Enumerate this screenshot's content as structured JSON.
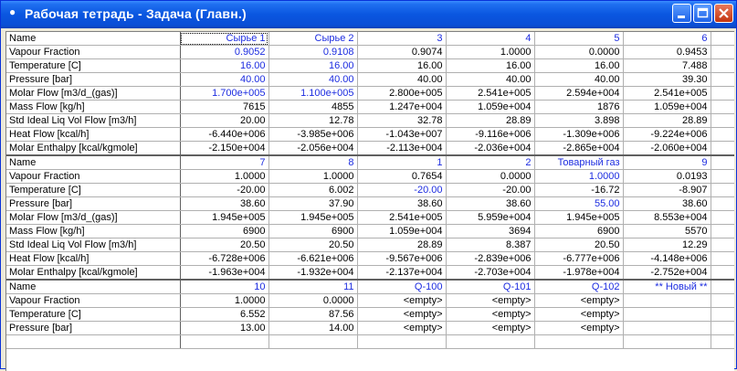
{
  "window": {
    "title": "Рабочая тетрадь - Задача (Главн.)",
    "minimize_label": "",
    "maximize_label": "",
    "close_label": ""
  },
  "grid": {
    "row_labels": [
      "Name",
      "Vapour Fraction",
      "Temperature [C]",
      "Pressure [bar]",
      "Molar Flow [m3/d_(gas)]",
      "Mass Flow [kg/h]",
      "Std Ideal Liq Vol Flow [m3/h]",
      "Heat Flow [kcal/h]",
      "Molar Enthalpy [kcal/kgmole]"
    ],
    "blocks": [
      {
        "names": [
          "Сырье 1",
          "Сырье 2",
          "3",
          "4",
          "5",
          "6"
        ],
        "rows": [
          [
            "0.9052",
            "0.9108",
            "0.9074",
            "1.0000",
            "0.0000",
            "0.9453"
          ],
          [
            "16.00",
            "16.00",
            "16.00",
            "16.00",
            "16.00",
            "7.488"
          ],
          [
            "40.00",
            "40.00",
            "40.00",
            "40.00",
            "40.00",
            "39.30"
          ],
          [
            "1.700e+005",
            "1.100e+005",
            "2.800e+005",
            "2.541e+005",
            "2.594e+004",
            "2.541e+005"
          ],
          [
            "7615",
            "4855",
            "1.247e+004",
            "1.059e+004",
            "1876",
            "1.059e+004"
          ],
          [
            "20.00",
            "12.78",
            "32.78",
            "28.89",
            "3.898",
            "28.89"
          ],
          [
            "-6.440e+006",
            "-3.985e+006",
            "-1.043e+007",
            "-9.116e+006",
            "-1.309e+006",
            "-9.224e+006"
          ],
          [
            "-2.150e+004",
            "-2.056e+004",
            "-2.113e+004",
            "-2.036e+004",
            "-2.865e+004",
            "-2.060e+004"
          ]
        ]
      },
      {
        "names": [
          "7",
          "8",
          "1",
          "2",
          "Товарный газ",
          "9"
        ],
        "rows": [
          [
            "1.0000",
            "1.0000",
            "0.7654",
            "0.0000",
            "1.0000",
            "0.0193"
          ],
          [
            "-20.00",
            "6.002",
            "-20.00",
            "-20.00",
            "-16.72",
            "-8.907"
          ],
          [
            "38.60",
            "37.90",
            "38.60",
            "38.60",
            "55.00",
            "38.60"
          ],
          [
            "1.945e+005",
            "1.945e+005",
            "2.541e+005",
            "5.959e+004",
            "1.945e+005",
            "8.553e+004"
          ],
          [
            "6900",
            "6900",
            "1.059e+004",
            "3694",
            "6900",
            "5570"
          ],
          [
            "20.50",
            "20.50",
            "28.89",
            "8.387",
            "20.50",
            "12.29"
          ],
          [
            "-6.728e+006",
            "-6.621e+006",
            "-9.567e+006",
            "-2.839e+006",
            "-6.777e+006",
            "-4.148e+006"
          ],
          [
            "-1.963e+004",
            "-1.932e+004",
            "-2.137e+004",
            "-2.703e+004",
            "-1.978e+004",
            "-2.752e+004"
          ]
        ]
      },
      {
        "names": [
          "10",
          "11",
          "Q-100",
          "Q-101",
          "Q-102",
          "** Новый **"
        ],
        "rows": [
          [
            "1.0000",
            "0.0000",
            "<empty>",
            "<empty>",
            "<empty>",
            ""
          ],
          [
            "6.552",
            "87.56",
            "<empty>",
            "<empty>",
            "<empty>",
            ""
          ],
          [
            "13.00",
            "14.00",
            "<empty>",
            "<empty>",
            "<empty>",
            ""
          ]
        ]
      }
    ]
  }
}
